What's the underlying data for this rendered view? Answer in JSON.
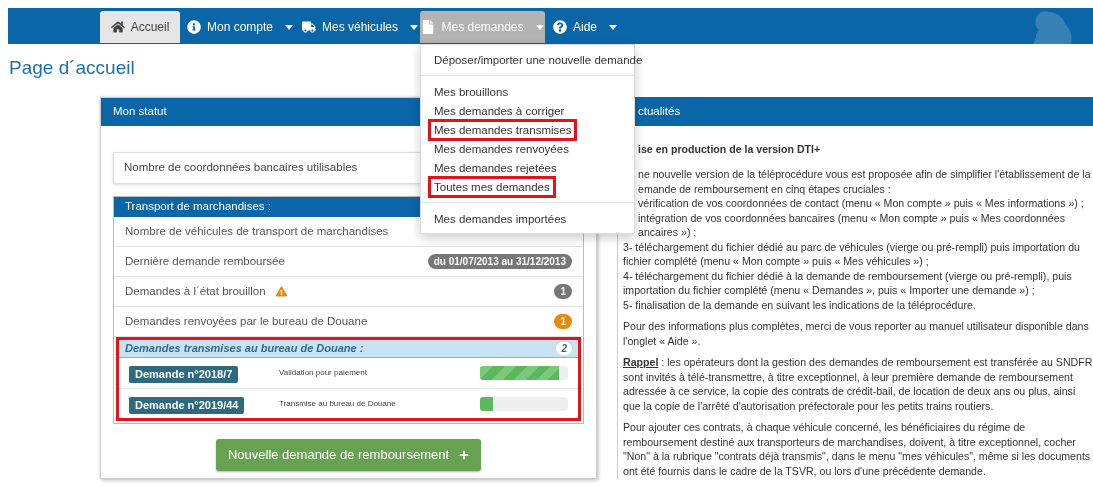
{
  "nav": {
    "items": [
      {
        "label": "Accueil",
        "selected": true,
        "open": false,
        "caret": false
      },
      {
        "label": "Mon compte",
        "selected": false,
        "open": false,
        "caret": true
      },
      {
        "label": "Mes véhicules",
        "selected": false,
        "open": false,
        "caret": true
      },
      {
        "label": "Mes demandes",
        "selected": false,
        "open": true,
        "caret": true
      },
      {
        "label": "Aide",
        "selected": false,
        "open": false,
        "caret": true
      }
    ]
  },
  "dropdown": {
    "groups": [
      [
        {
          "label": "Déposer/importer une nouvelle demande",
          "highlighted": false
        }
      ],
      [
        {
          "label": "Mes brouillons",
          "highlighted": false
        },
        {
          "label": "Mes demandes à corriger",
          "highlighted": false
        },
        {
          "label": "Mes demandes transmises",
          "highlighted": true
        },
        {
          "label": "Mes demandes renvoyées",
          "highlighted": false
        },
        {
          "label": "Mes demandes rejetées",
          "highlighted": false
        },
        {
          "label": "Toutes mes demandes",
          "highlighted": true
        }
      ],
      [
        {
          "label": "Mes demandes importées",
          "highlighted": false
        }
      ]
    ]
  },
  "page_title": "Page d´accueil",
  "status_panel": {
    "title": "Mon statut",
    "bank_card": {
      "label": "Nombre de coordonnées bancaires utilisables"
    },
    "transport": {
      "title": "Transport de marchandises :",
      "rows": [
        {
          "label": "Nombre de véhicules de transport de marchandises",
          "warning": false
        },
        {
          "label": "Dernière demande remboursée",
          "badge": "du 01/07/2013 au 31/12/2013",
          "warning": false,
          "color": "#777777"
        },
        {
          "label": "Demandes à l´état brouillon",
          "badge": "1",
          "warning": true,
          "color": "#777777"
        },
        {
          "label": "Demandes renvoyées par le bureau de Douane",
          "badge": "1",
          "warning": false,
          "color": "#e48a0c"
        }
      ],
      "transmitted": {
        "title": "Demandes transmises au bureau de Douane :",
        "count": "2",
        "highlighted": true,
        "requests": [
          {
            "label": "Demande n°2018/7",
            "status": "Validation pour paiement",
            "level": 0.9,
            "striped": true
          },
          {
            "label": "Demande n°2019/44",
            "status": "Transmise au bureau de Douane",
            "level": 0.15,
            "striped": false
          }
        ]
      }
    },
    "button": "Nouvelle demande de remboursement"
  },
  "news_panel": {
    "title": "ctualités",
    "title_clipped": true,
    "heading": "ise en production de la version DTI+",
    "lines": [
      {
        "text": "ne nouvelle version de la téléprocédure vous est proposée afin de simplifier l'établissement de la",
        "clipped": true
      },
      {
        "text": "emande de remboursement en cinq étapes cruciales :",
        "clipped": true
      },
      {
        "text": "vérification de vos coordonnées de contact (menu « Mon compte » puis « Mes informations ») ;",
        "clipped": true
      },
      {
        "text": "intégration de vos coordonnées bancaires (menu « Mon compte » puis « Mes coordonnées",
        "clipped": true
      },
      {
        "text": "ancaires ») ;",
        "clipped": true
      },
      {
        "text": "3- téléchargement du fichier dédié au parc de véhicules (vierge ou pré-rempli) puis importation du",
        "clipped": false
      },
      {
        "text": "fichier complété (menu « Mon compte » puis « Mes véhicules ») ;",
        "clipped": false
      },
      {
        "text": "4- téléchargement du fichier dédié à la demande de remboursement (vierge ou pré-rempli), puis",
        "clipped": false
      },
      {
        "text": "importation du fichier complété (menu « Demandes », puis « Importer une demande ») ;",
        "clipped": false
      },
      {
        "text": "5- finalisation de la demande en suivant les indications de la téléprocédure.",
        "clipped": false
      }
    ],
    "paragraphs": [
      {
        "text": "Pour des informations plus complètes, merci de vous reporter au manuel utilisateur disponible dans l'onglet « Aide »."
      },
      {
        "lead": "Rappel",
        "text": " : les opérateurs dont la gestion des demandes de remboursement est transférée au SNDFR sont invités à télé-transmettre, à titre exceptionnel, à leur première demande de remboursement adressée à ce service, la copie des contrats de crédit-bail, de location de deux ans ou plus, ainsi que la copie de l'arrêté d'autorisation préfectorale pour les petits trains routiers."
      },
      {
        "text": "Pour ajouter ces contrats, à chaque véhicule concerné, les bénéficiaires du régime de remboursement destiné aux transporteurs de marchandises, doivent, à titre exceptionnel, cocher \"Non\" à la rubrique \"contrats déjà transmis\", dans le menu \"mes véhicules\", même si les documents ont été fournis dans le cadre de la TSVR, ou lors d'une précédente demande."
      }
    ]
  }
}
